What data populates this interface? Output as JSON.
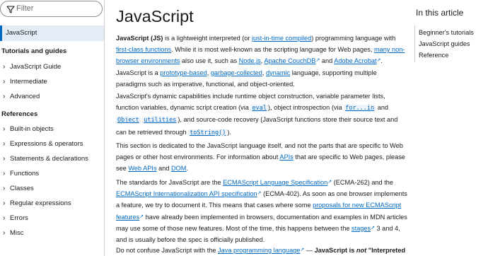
{
  "sidebar": {
    "filter_placeholder": "Filter",
    "active_item": "JavaScript",
    "sections": [
      {
        "heading": "Tutorials and guides",
        "items": [
          "JavaScript Guide",
          "Intermediate",
          "Advanced"
        ]
      },
      {
        "heading": "References",
        "items": [
          "Built-in objects",
          "Expressions & operators",
          "Statements & declarations",
          "Functions",
          "Classes",
          "Regular expressions",
          "Errors",
          "Misc"
        ]
      }
    ]
  },
  "main": {
    "title": "JavaScript",
    "p1": {
      "t0": "JavaScript (JS)",
      "t1": " is a lightweight interpreted (or ",
      "l1": "just-in-time compiled",
      "t2": ") programming language with ",
      "l2": "first-class functions",
      "t3": ". While it is most well-known as the scripting language for Web pages, ",
      "l3": "many non-browser environments",
      "t4": " also use it, such as ",
      "l4": "Node.js",
      "t5": ", ",
      "l5": "Apache CouchDB",
      "t6": " and ",
      "l6": "Adobe Acrobat",
      "t7": ". JavaScript is a ",
      "l7": "prototype-based",
      "t8": ", ",
      "l8": "garbage-collected",
      "t9": ", ",
      "l9": "dynamic",
      "t10": " language, supporting multiple paradigms such as imperative, functional, and object-oriented."
    },
    "p2": {
      "t1": "JavaScript's dynamic capabilities include runtime object construction, variable parameter lists, function variables, dynamic script creation (via ",
      "c1": "eval",
      "t2": "), object introspection (via ",
      "c2": "for...in",
      "t3": " and ",
      "c3a": "Object",
      "c3b": "utilities",
      "t4": "), and source-code recovery (JavaScript functions store their source text and can be retrieved through ",
      "c4": "toString()",
      "t5": ")."
    },
    "p3": {
      "t1": "This section is dedicated to the JavaScript language itself, and not the parts that are specific to Web pages or other host environments. For information about ",
      "l1": "APIs",
      "t2": " that are specific to Web pages, please see ",
      "l2": "Web APIs",
      "t3": " and ",
      "l3": "DOM",
      "t4": "."
    },
    "p4": {
      "t1": "The standards for JavaScript are the ",
      "l1": "ECMAScript Language Specification",
      "t2": " (ECMA-262) and the ",
      "l2": "ECMAScript Internationalization API specification",
      "t3": " (ECMA-402). As soon as one browser implements a feature, we try to document it. This means that cases where some ",
      "l3": "proposals for new ECMAScript features",
      "t4": " have already been implemented in browsers, documentation and examples in MDN articles may use some of those new features. Most of the time, this happens between the ",
      "l4": "stages",
      "t5": " 3 and 4, and is usually before the spec is officially published."
    },
    "p5": {
      "t1": "Do not confuse JavaScript with the ",
      "l1": "Java programming language",
      "t2": " — ",
      "b1": "JavaScript is ",
      "b2": "not",
      "b3": " \"Interpreted"
    }
  },
  "toc": {
    "title": "In this article",
    "items": [
      "Beginner's tutorials",
      "JavaScript guides",
      "Reference"
    ]
  },
  "colors": {
    "link": "#0069c2",
    "active_bg": "#e3ecf7",
    "text": "#1b1b1b"
  }
}
